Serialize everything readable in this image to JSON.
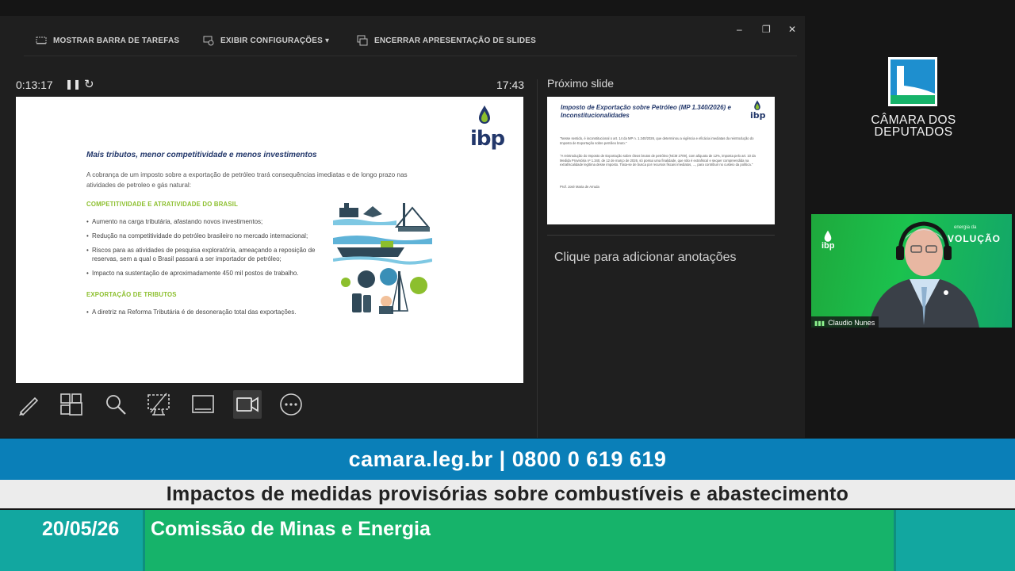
{
  "toolbar": {
    "show_taskbar": "MOSTRAR BARRA DE TAREFAS",
    "display_settings": "EXIBIR CONFIGURAÇÕES ▾",
    "end_slideshow": "ENCERRAR APRESENTAÇÃO DE SLIDES"
  },
  "window_controls": {
    "minimize": "–",
    "restore": "❐",
    "close": "✕"
  },
  "presenter": {
    "elapsed": "0:13:17",
    "clock": "17:43",
    "next_slide_label": "Próximo slide",
    "notes_placeholder": "Clique para adicionar anotações"
  },
  "current_slide": {
    "logo": "ibp",
    "heading": "Mais tributos, menor competitividade e menos investimentos",
    "intro": "A cobrança de um imposto sobre a exportação de petróleo trará consequências imediatas e de longo prazo nas atividades de petroleo e gás natural:",
    "section1": "COMPETITIVIDADE E ATRATIVIDADE DO BRASIL",
    "bullets1": [
      "Aumento na carga tributária, afastando novos investimentos;",
      "Redução na competitividade do petróleo brasileiro no mercado internacional;",
      "Riscos para as atividades de pesquisa exploratória, ameaçando a reposição de reservas, sem a qual o Brasil passará a ser importador de petróleo;",
      "Impacto na sustentação de aproximadamente 450 mil postos de trabalho."
    ],
    "section2": "EXPORTAÇÃO DE TRIBUTOS",
    "bullets2": [
      "A diretriz na Reforma Tributária é de desoneração total das exportações."
    ]
  },
  "next_slide": {
    "logo": "ibp",
    "title": "Imposto de Exportação sobre Petróleo (MP 1.340/2026) e Inconstitucionalidades",
    "p1": "\"Nesse sentido, é inconstitucional o art. 14 da MP n. 1.340/2026, que determinou a vigência e eficácia imediatas da reintrodução do Imposto de Exportação sobre petróleo bruto.\"",
    "p2": "\"A reintrodução do Imposto de Exportação sobre óleos brutos de petróleo (NCM 2709), com alíquota de 12%, imposta pelo art. 10 da Medida Provisória nº 1.340, de 12 de março de 2026, só possui uma finalidade, que não é extrafiscal e sequer compreendida na extrafiscalidade legítima desse imposto. Trata-se de busca por recursos fiscais imediatos, ..., para contribuir no custeio da política.\"",
    "author": "Prof. José Maria de Arruda"
  },
  "branding": {
    "camara_line1": "CÂMARA DOS",
    "camara_line2": "DEPUTADOS",
    "video_name": "Claudio Nunes",
    "video_banner_small": "energia da",
    "video_banner_big": "VOLUÇÃO",
    "video_logo": "ibp"
  },
  "broadcast": {
    "contact": "camara.leg.br | 0800 0 619 619",
    "topic": "Impactos de medidas provisórias sobre combustíveis e abastecimento",
    "date": "20/05/26",
    "committee": "Comissão de Minas e Energia"
  },
  "colors": {
    "blue_bar": "#0a7fb8",
    "green_bar": "#16b36a",
    "teal_bar": "#12a7a0",
    "ibp_navy": "#23386b",
    "ibp_green": "#8cbf2d"
  }
}
